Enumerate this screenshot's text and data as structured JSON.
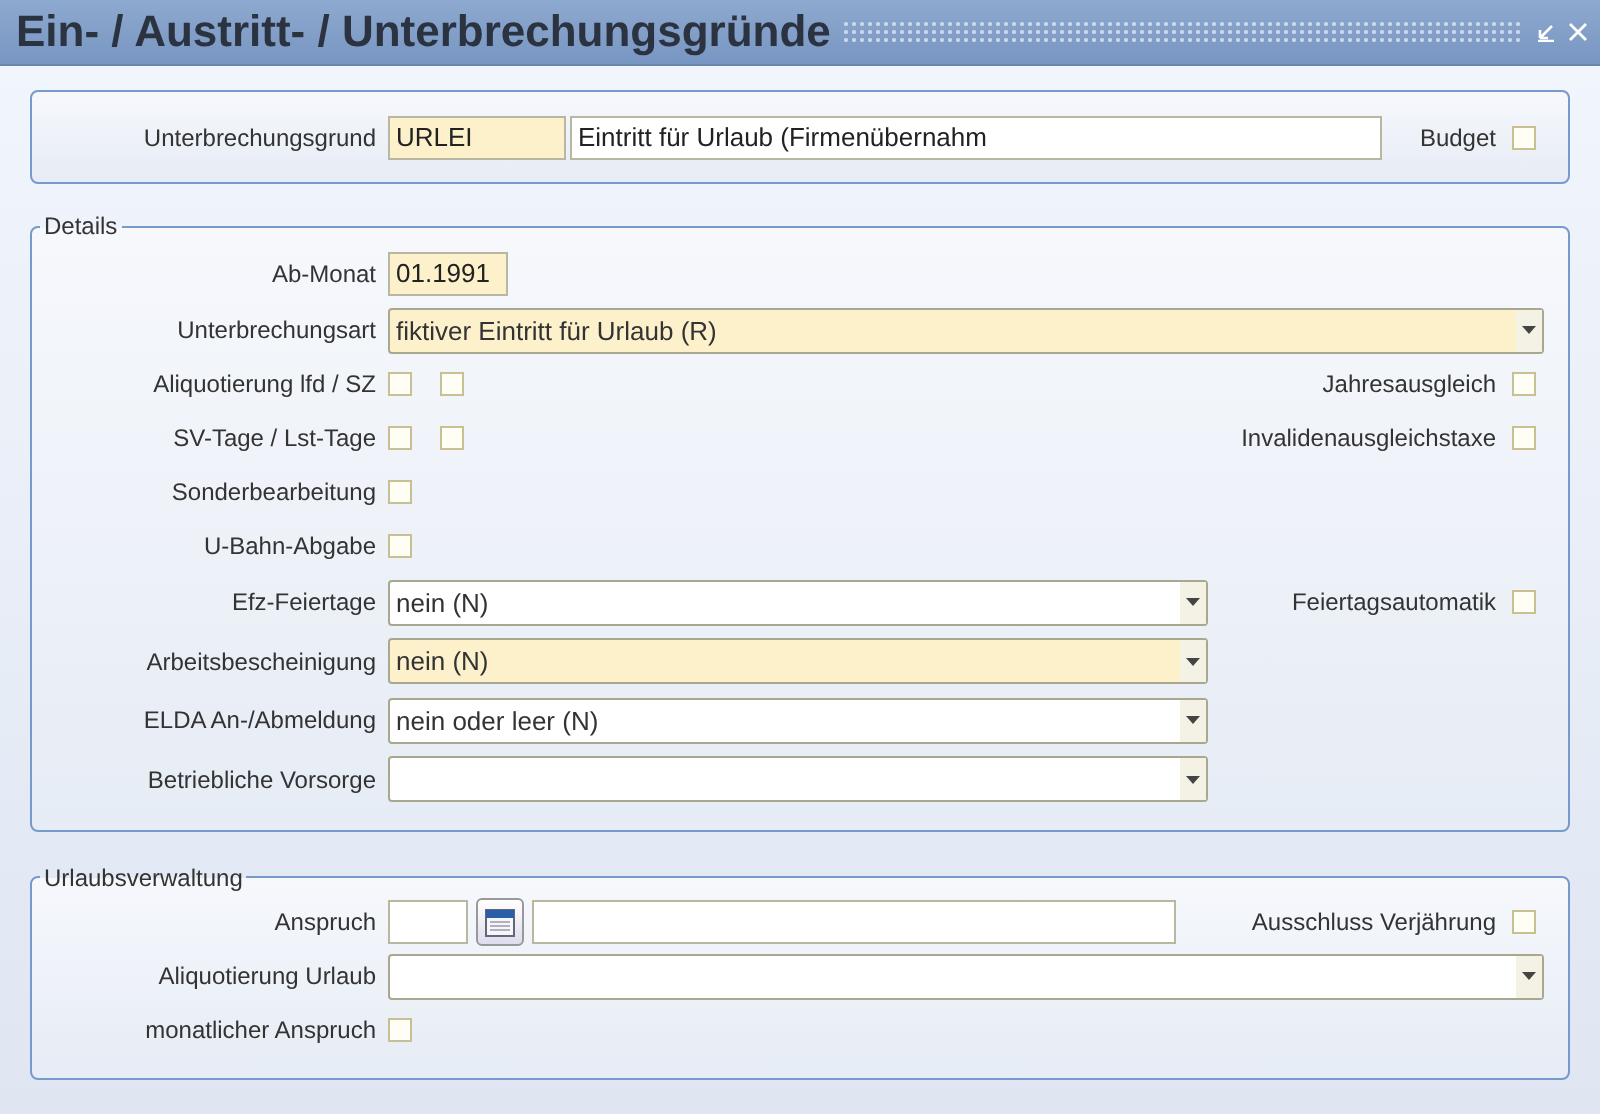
{
  "title": "Ein- / Austritt- / Unterbrechungsgründe",
  "header": {
    "label": "Unterbrechungsgrund",
    "code": "URLEI",
    "code_required": true,
    "description": "Eintritt für Urlaub (Firmenübernahm",
    "budget": {
      "label": "Budget",
      "checked": false
    }
  },
  "details": {
    "legend": "Details",
    "rows": [
      {
        "kind": "short-input",
        "label": "Ab-Monat",
        "value": "01.1991",
        "required": true
      },
      {
        "kind": "wide-select",
        "label": "Unterbrechungsart",
        "value": "fiktiver Eintritt für Urlaub (R)",
        "required": true
      },
      {
        "kind": "checks",
        "label": "Aliquotierung lfd / SZ",
        "checks": [
          {
            "checked": false
          },
          {
            "checked": false
          }
        ],
        "right": {
          "label": "Jahresausgleich",
          "checked": false
        }
      },
      {
        "kind": "checks",
        "label": "SV-Tage / Lst-Tage",
        "checks": [
          {
            "checked": false
          },
          {
            "checked": false
          }
        ],
        "right": {
          "label": "Invalidenausgleichstaxe",
          "checked": false
        }
      },
      {
        "kind": "checks",
        "label": "Sonderbearbeitung",
        "checks": [
          {
            "checked": false
          }
        ]
      },
      {
        "kind": "checks",
        "label": "U-Bahn-Abgabe",
        "checks": [
          {
            "checked": false
          }
        ]
      },
      {
        "kind": "select",
        "label": "Efz-Feiertage",
        "value": "nein (N)",
        "required": false,
        "right": {
          "label": "Feiertagsautomatik",
          "checked": false
        }
      },
      {
        "kind": "select",
        "label": "Arbeitsbescheinigung",
        "value": "nein (N)",
        "required": true
      },
      {
        "kind": "select",
        "label": "ELDA An-/Abmeldung",
        "value": "nein oder leer (N)",
        "required": false
      },
      {
        "kind": "select",
        "label": "Betriebliche Vorsorge",
        "required": false
      }
    ]
  },
  "vacation": {
    "legend": "Urlaubsverwaltung",
    "rows": [
      {
        "kind": "date-input",
        "label": "Anspruch",
        "right": {
          "label": "Ausschluss Verjährung",
          "checked": false
        }
      },
      {
        "kind": "wide-select",
        "label": "Aliquotierung Urlaub",
        "required": false
      },
      {
        "kind": "checks",
        "label": "monatlicher Anspruch",
        "checks": [
          {
            "checked": false
          }
        ]
      }
    ]
  }
}
